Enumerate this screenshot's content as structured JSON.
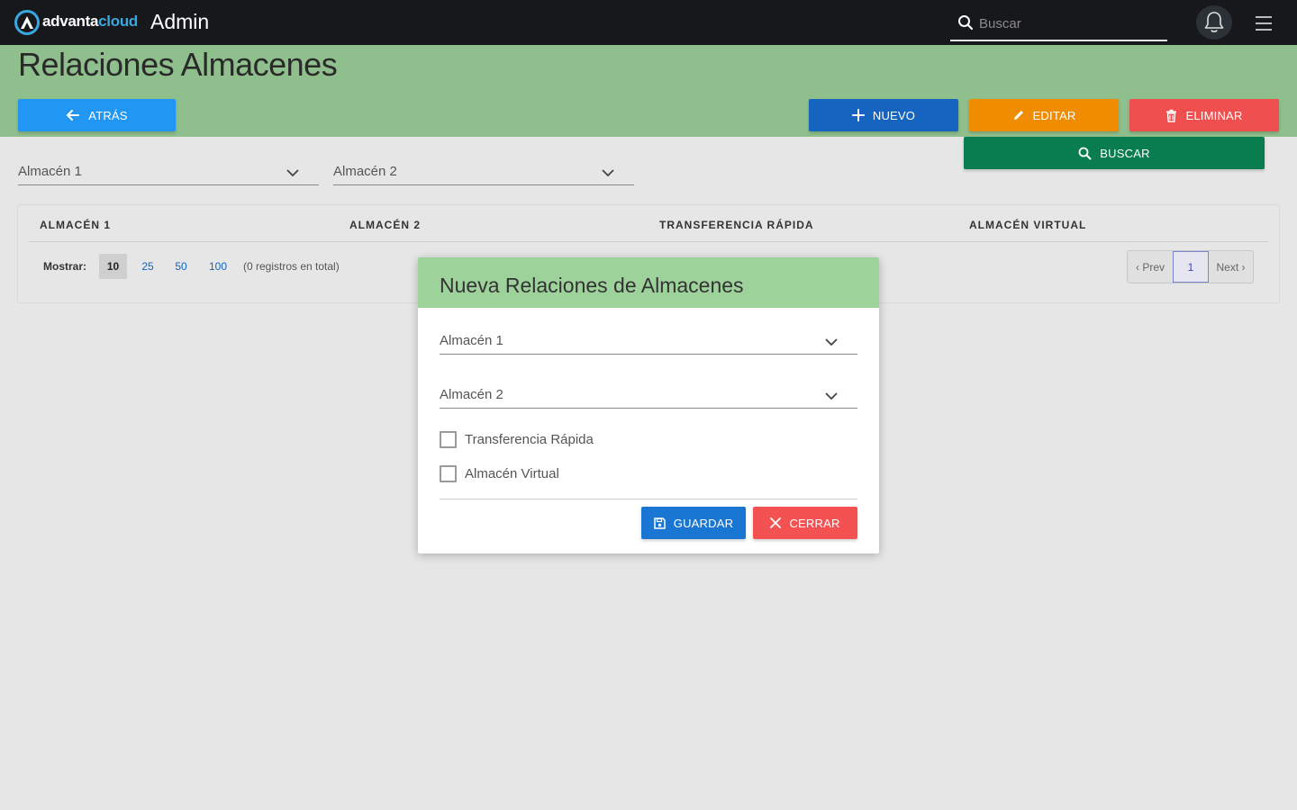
{
  "topbar": {
    "logo_text_main": "advanta",
    "logo_text_accent": "cloud",
    "app_title": "Admin",
    "search_placeholder": "Buscar"
  },
  "header": {
    "title": "Relaciones Almacenes",
    "back_label": "ATRÁS",
    "new_label": "NUEVO",
    "edit_label": "EDITAR",
    "delete_label": "ELIMINAR",
    "search_label": "BUSCAR"
  },
  "filters": {
    "almacen1_label": "Almacén 1",
    "almacen2_label": "Almacén 2"
  },
  "table": {
    "columns": [
      "ALMACÉN 1",
      "ALMACÉN 2",
      "TRANSFERENCIA RÁPIDA",
      "ALMACÉN VIRTUAL"
    ],
    "show_label": "Mostrar:",
    "page_sizes": [
      "10",
      "25",
      "50",
      "100"
    ],
    "active_page_size": "10",
    "records_text": "(0 registros en total)",
    "pager": {
      "prev": "‹ Prev",
      "current": "1",
      "next": "Next ›"
    }
  },
  "modal": {
    "title": "Nueva Relaciones de Almacenes",
    "almacen1_label": "Almacén 1",
    "almacen2_label": "Almacén 2",
    "check_transferencia": "Transferencia Rápida",
    "check_virtual": "Almacén Virtual",
    "save_label": "GUARDAR",
    "close_label": "CERRAR"
  },
  "colors": {
    "topbar": "#16181b",
    "header_green": "#8fbf8c",
    "modal_header_green": "#9ed29b",
    "primary_blue": "#2196f3",
    "dark_blue": "#1565c0",
    "orange": "#ef8c00",
    "red": "#ef4f4f",
    "dark_green": "#0a7d50"
  }
}
